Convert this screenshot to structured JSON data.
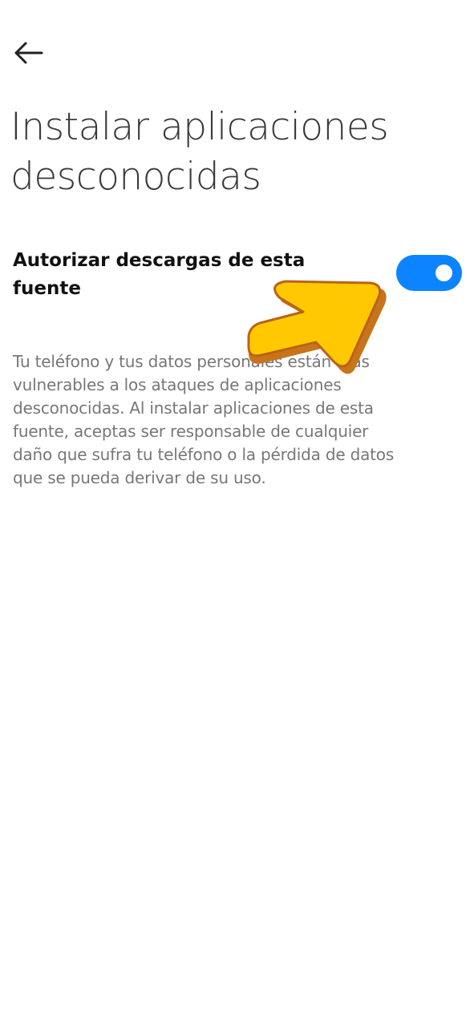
{
  "header": {
    "back_icon": "arrow-left-icon"
  },
  "page": {
    "title_lines": [
      "Instalar aplicaciones",
      "desconocidas"
    ]
  },
  "setting": {
    "label_lines": [
      "Autorizar descargas de esta",
      "fuente"
    ],
    "toggle_on": true,
    "accent_color": "#0c84ff"
  },
  "description": {
    "lines": [
      "Tu teléfono y tus datos personales están más",
      "vulnerables a los ataques de aplicaciones",
      "desconocidas. Al instalar aplicaciones de esta",
      "fuente, aceptas ser responsable de cualquier",
      "daño que sufra tu teléfono o la pérdida de datos",
      "que se pueda derivar de su uso."
    ]
  },
  "annotation": {
    "icon": "pointer-arrow-icon",
    "color": "#ffc800",
    "outline_color": "#c8741a"
  }
}
